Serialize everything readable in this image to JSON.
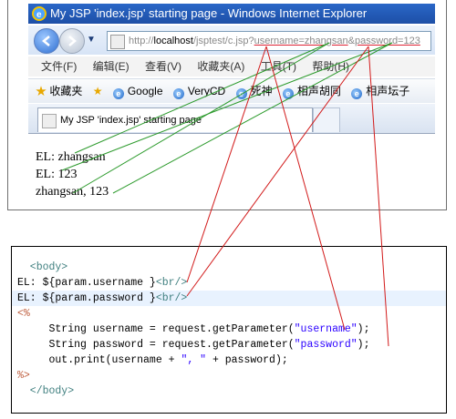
{
  "browser": {
    "title": "My JSP 'index.jsp' starting page - Windows Internet Explorer",
    "url": {
      "prefix": "http://",
      "host": "localhost",
      "path": "/jsptest/c.jsp?",
      "param1": "username=zhangsan",
      "amp": "&",
      "param2": "password=123"
    },
    "menu": [
      "文件(F)",
      "编辑(E)",
      "查看(V)",
      "收藏夹(A)",
      "工具(T)",
      "帮助(H)"
    ],
    "favorites_label": "收藏夹",
    "bookmarks": [
      "Google",
      "VeryCD",
      "死神",
      "相声胡同",
      "相声坛子"
    ],
    "tab_title": "My JSP 'index.jsp' starting page",
    "output_lines": [
      "EL: zhangsan",
      "EL: 123",
      "zhangsan, 123"
    ]
  },
  "code": {
    "lines": [
      {
        "t": "  <body>",
        "cls": "tag"
      },
      {
        "t": "EL: ${param.username }<br/>",
        "cls": "el"
      },
      {
        "t": "EL: ${param.password }<br/>",
        "cls": "el",
        "hl": true
      },
      {
        "t": "<%",
        "cls": "jsp"
      },
      {
        "t": "     String username = request.getParameter(\"username\");",
        "cls": "plain"
      },
      {
        "t": "     String password = request.getParameter(\"password\");",
        "cls": "plain"
      },
      {
        "t": "     out.print(username + \", \" + password);",
        "cls": "plain"
      },
      {
        "t": "%>",
        "cls": "jsp"
      },
      {
        "t": "  </body>",
        "cls": "tag"
      }
    ]
  },
  "colors": {
    "green_lines": "#2b9a2b",
    "red_lines": "#d21a1a"
  }
}
